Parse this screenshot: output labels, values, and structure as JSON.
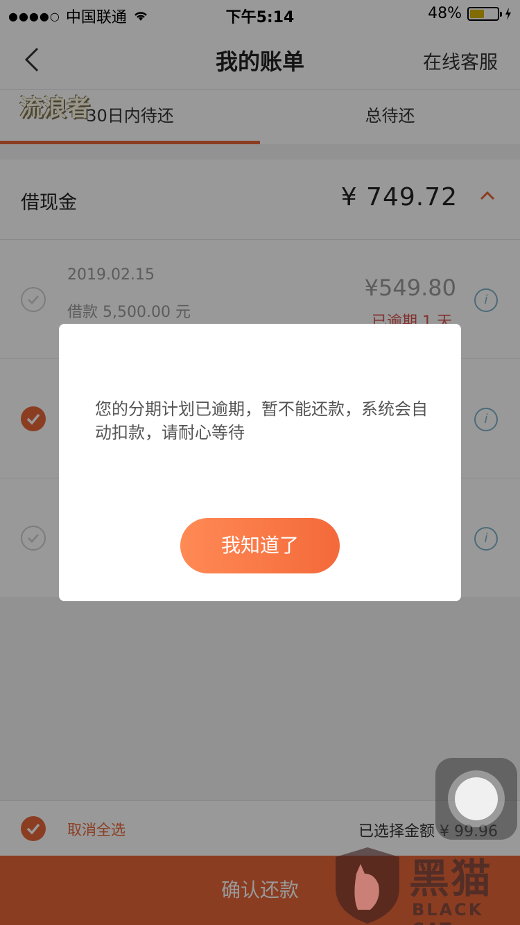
{
  "status_bar": {
    "signal": "●●●●○",
    "carrier": "中国联通",
    "time": "下午5:14",
    "battery_text": "48%"
  },
  "nav": {
    "title": "我的账单",
    "service": "在线客服"
  },
  "tabs": [
    {
      "label": "30日内待还",
      "active": true
    },
    {
      "label": "总待还",
      "active": false
    }
  ],
  "watermark_top": "流浪者",
  "section": {
    "title": "借现金",
    "total": "¥ 749.72"
  },
  "rows": [
    {
      "date": "2019.02.15",
      "loan": "借款 5,500.00 元",
      "amount": "¥549.80",
      "status": "已逾期 1 天",
      "checked": false
    },
    {
      "checked": true
    },
    {
      "checked": false
    }
  ],
  "bottom": {
    "deselect": "取消全选",
    "selected_amount": "已选择金额 ¥ 99.96",
    "confirm": "确认还款"
  },
  "dialog": {
    "message": "您的分期计划已逾期，暂不能还款，系统会自动扣款，请耐心等待",
    "button": "我知道了"
  },
  "brand": {
    "cn": "黑猫",
    "en": "BLACK CAT"
  },
  "colors": {
    "accent": "#e8663a",
    "overdue": "#d9534f",
    "info": "#7fb2c9"
  }
}
